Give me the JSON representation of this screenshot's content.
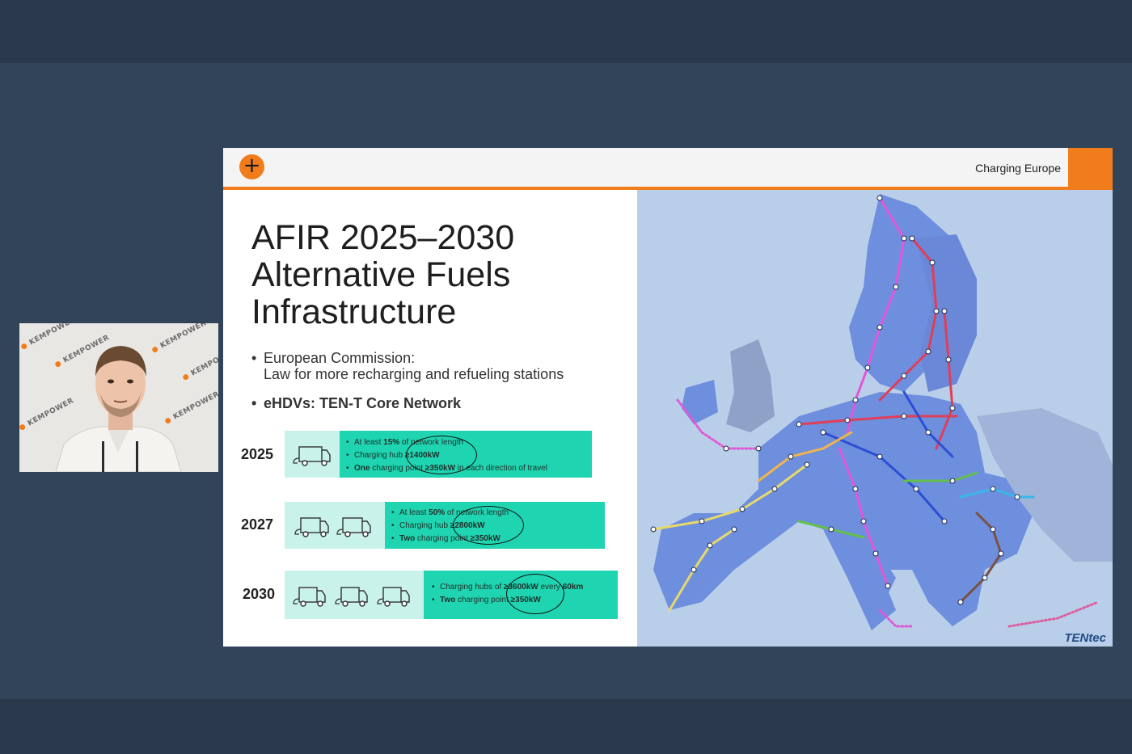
{
  "slide": {
    "header_title": "Charging Europe",
    "plus_symbol": "+",
    "title_lines": [
      "AFIR 2025–2030",
      "Alternative Fuels",
      "Infrastructure"
    ],
    "bullets": {
      "b1_line1": "European Commission:",
      "b1_line2": "Law for more recharging and refueling stations",
      "b2": "eHDVs: TEN-T Core Network"
    },
    "rows": [
      {
        "year": "2025",
        "truck_count": 1,
        "lines": [
          {
            "pre": "At least ",
            "bold": "15%",
            "post": " of network length"
          },
          {
            "pre": "Charging hub ",
            "bold": "≥1400kW",
            "post": ""
          },
          {
            "pre": "",
            "bold": "One",
            "post": " charging point ",
            "bold2": "≥350kW",
            "post2": " in each direction of travel"
          }
        ]
      },
      {
        "year": "2027",
        "truck_count": 2,
        "lines": [
          {
            "pre": "At least ",
            "bold": "50%",
            "post": " of network length"
          },
          {
            "pre": "Charging hub ",
            "bold": "≥2800kW",
            "post": ""
          },
          {
            "pre": "",
            "bold": "Two",
            "post": " charging point ",
            "bold2": "≥350kW",
            "post2": ""
          }
        ]
      },
      {
        "year": "2030",
        "truck_count": 3,
        "lines": [
          {
            "pre": "Charging hubs of ",
            "bold": "≥3600kW",
            "post": " every ",
            "bold2": "60km",
            "post2": ""
          },
          {
            "pre": "",
            "bold": "Two",
            "post": " charging point ",
            "bold2": "≥350kW",
            "post2": ""
          }
        ]
      }
    ],
    "map_logo": "TENtec"
  },
  "webcam": {
    "watermark": "KEMPOWER"
  },
  "colors": {
    "accent_orange": "#f07c1c",
    "spec_green": "#1fd4b0",
    "truck_bg": "#c9f3ea",
    "map_sea": "#b9cfe9",
    "map_land": "#6e8ede"
  }
}
